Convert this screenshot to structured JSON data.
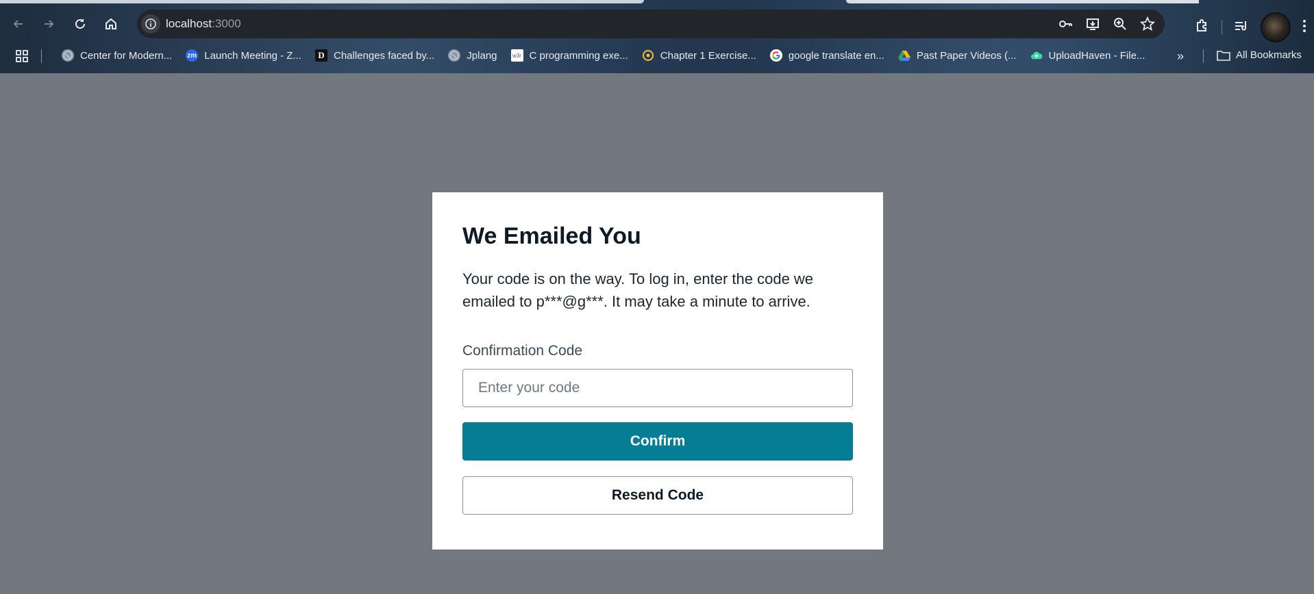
{
  "browser": {
    "url_host": "localhost",
    "url_port": ":3000",
    "bookmarks": [
      {
        "label": "Center for Modern...",
        "icon": "globe-icon",
        "color": "#8a98a8"
      },
      {
        "label": "Launch Meeting - Z...",
        "icon": "zoom-icon",
        "color": "#2d68e8"
      },
      {
        "label": "Challenges faced by...",
        "icon": "d-logo-icon",
        "color": "#111111"
      },
      {
        "label": "Jplang",
        "icon": "globe-icon",
        "color": "#8a98a8"
      },
      {
        "label": "C programming exe...",
        "icon": "w3r-icon",
        "color": "#ffffff"
      },
      {
        "label": "Chapter 1 Exercise...",
        "icon": "compass-icon",
        "color": "#f0c22b"
      },
      {
        "label": "google translate en...",
        "icon": "google-icon",
        "color": "#ffffff"
      },
      {
        "label": "Past Paper Videos (...",
        "icon": "drive-icon",
        "color": "#34a853"
      },
      {
        "label": "UploadHaven - File...",
        "icon": "cloud-icon",
        "color": "#3dd6a3"
      }
    ],
    "all_bookmarks_label": "All Bookmarks",
    "bookmark_icon_text": {
      "zoom": "zm",
      "d": "D",
      "w3r": "w3r"
    }
  },
  "card": {
    "title": "We Emailed You",
    "description": "Your code is on the way. To log in, enter the code we emailed to p***@g***. It may take a minute to arrive.",
    "code_label": "Confirmation Code",
    "code_placeholder": "Enter your code",
    "confirm_label": "Confirm",
    "resend_label": "Resend Code"
  },
  "colors": {
    "page_background": "#727780",
    "primary_button": "#047d95"
  }
}
